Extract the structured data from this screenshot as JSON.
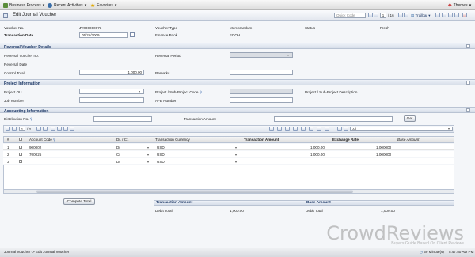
{
  "topmenu": {
    "business_process": "Business Process",
    "recent_activities": "Recent Activities",
    "favorites": "Favorites",
    "themes": "Themes"
  },
  "toolbar": {
    "quick_code_placeholder": "Quick Code",
    "page_current": "1",
    "page_total": "/ 16",
    "trailbar": "Trailbar"
  },
  "window": {
    "title": "Edit Journal Voucher"
  },
  "header": {
    "voucher_no_label": "Voucher No.",
    "voucher_no_value": "JV000000073",
    "voucher_type_label": "Voucher Type",
    "voucher_type_value": "Memorandum",
    "status_label": "Status",
    "status_value": "Fresh",
    "transaction_date_label": "Transaction Date",
    "transaction_date_value": "05/25/2009",
    "finance_book_label": "Finance Book",
    "finance_book_value": "FOCH"
  },
  "reversal": {
    "title": "Reversal Voucher Details",
    "voucher_no_label": "Reversal Voucher no.",
    "period_label": "Reversal Period",
    "date_label": "Reversal Date",
    "control_total_label": "Control Total",
    "control_total_value": "1,000.00",
    "remarks_label": "Remarks"
  },
  "project": {
    "title": "Project Information",
    "ou_label": "Project OU",
    "code_label": "Project / Sub-Project Code",
    "desc_label": "Project / Sub-Project Description",
    "job_label": "Job Number",
    "afe_label": "AFE Number"
  },
  "accounting": {
    "title": "Accounting Information",
    "distribution_label": "Distribution No.",
    "transaction_amount_label": "Transaction Amount",
    "get_button": "Get"
  },
  "grid": {
    "page_current": "1",
    "page_total": "/ 2",
    "filter_value": "All",
    "headers": {
      "num": "#",
      "account_code": "Account Code",
      "dr_cr": "Dr. / Cr.",
      "currency": "Transaction Currency",
      "amount": "Transaction Amount",
      "rate": "Exchange Rate",
      "base": "Base Amount"
    },
    "rows": [
      {
        "num": "1",
        "account": "900002",
        "drcr": "Dr",
        "currency": "USD",
        "amount": "1,000.00",
        "rate": "1.000000"
      },
      {
        "num": "2",
        "account": "700025",
        "drcr": "Cr",
        "currency": "USD",
        "amount": "1,000.00",
        "rate": "1.000000"
      },
      {
        "num": "3",
        "account": "",
        "drcr": "Dr",
        "currency": "USD",
        "amount": "",
        "rate": ""
      }
    ]
  },
  "summary": {
    "compute_button": "Compute Total",
    "txn_header": "Transaction Amount",
    "base_header": "Base Amount",
    "debit_label": "Debit Total",
    "debit_value": "1,000.00",
    "base_debit_label": "Debit Total",
    "base_debit_value": "1,000.00"
  },
  "statusbar": {
    "breadcrumb": "Journal Voucher -> Edit Journal Voucher",
    "timer": "59 Minute(s)",
    "time": "5:47:50 AM PM"
  },
  "watermark": {
    "brand": "CrowdReviews",
    "tagline": "Buyers Guide Based On Client Reviews"
  }
}
